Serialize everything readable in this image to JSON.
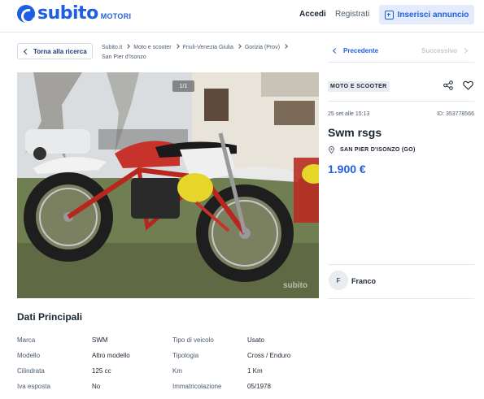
{
  "header": {
    "logo_text": "subito",
    "logo_sub": "MOTORI",
    "accedi": "Accedi",
    "registrati": "Registrati",
    "inserisci": "Inserisci annuncio"
  },
  "back_label": "Torna alla ricerca",
  "breadcrumb": [
    "Subito.it",
    "Moto e scooter",
    "Friuli-Venezia Giulia",
    "Gorizia (Prov)",
    "San Pier d'Isonzo"
  ],
  "photo": {
    "counter": "1/1",
    "watermark": "subito"
  },
  "nav": {
    "prev": "Precedente",
    "next": "Successivo"
  },
  "ad": {
    "category": "MOTO E SCOOTER",
    "date": "25 set alle 15:13",
    "id": "ID: 353778566",
    "title": "Swm rsgs",
    "location": "SAN PIER D'ISONZO (GO)",
    "price": "1.900 €"
  },
  "seller": {
    "initial": "F",
    "name": "Franco"
  },
  "details": {
    "title": "Dati Principali",
    "rows": [
      {
        "label1": "Marca",
        "value1": "SWM",
        "label2": "Tipo di veicolo",
        "value2": "Usato"
      },
      {
        "label1": "Modello",
        "value1": "Altro modello",
        "label2": "Tipologia",
        "value2": "Cross / Enduro"
      },
      {
        "label1": "Cilindrata",
        "value1": "125 cc",
        "label2": "Km",
        "value2": "1 Km"
      },
      {
        "label1": "Iva esposta",
        "value1": "No",
        "label2": "Immatricolazione",
        "value2": "05/1978"
      }
    ]
  },
  "colors": {
    "brand": "#1f5ee0",
    "text": "#1b2532",
    "muted": "#4a5a6e"
  }
}
